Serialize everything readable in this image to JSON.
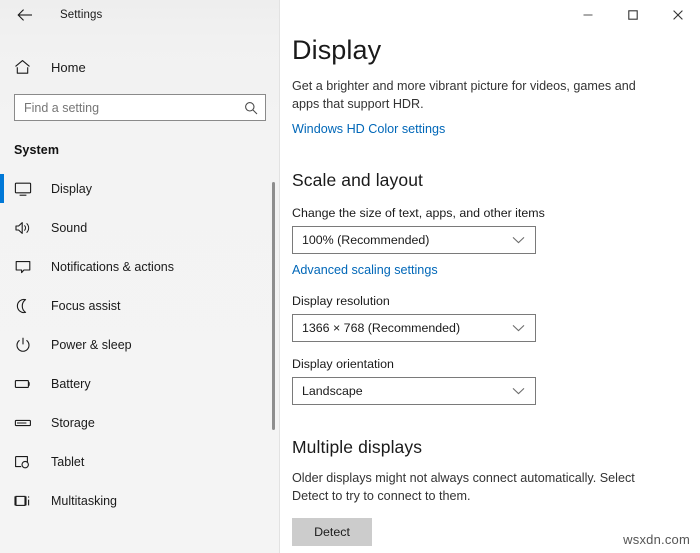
{
  "window": {
    "app_title": "Settings",
    "back_icon": "back-arrow-icon",
    "controls": {
      "minimize_label": "Minimize",
      "maximize_label": "Maximize",
      "close_label": "Close"
    }
  },
  "sidebar": {
    "home_label": "Home",
    "home_icon": "home-icon",
    "search": {
      "placeholder": "Find a setting",
      "value": "",
      "icon": "search-icon"
    },
    "section_label": "System",
    "accent_color": "#0078d7",
    "items": [
      {
        "label": "Display",
        "icon": "monitor-icon",
        "selected": true
      },
      {
        "label": "Sound",
        "icon": "speaker-icon",
        "selected": false
      },
      {
        "label": "Notifications & actions",
        "icon": "notification-icon",
        "selected": false
      },
      {
        "label": "Focus assist",
        "icon": "moon-icon",
        "selected": false
      },
      {
        "label": "Power & sleep",
        "icon": "power-icon",
        "selected": false
      },
      {
        "label": "Battery",
        "icon": "battery-icon",
        "selected": false
      },
      {
        "label": "Storage",
        "icon": "storage-icon",
        "selected": false
      },
      {
        "label": "Tablet",
        "icon": "tablet-icon",
        "selected": false
      },
      {
        "label": "Multitasking",
        "icon": "multitasking-icon",
        "selected": false
      }
    ]
  },
  "main": {
    "page_title": "Display",
    "hdr_description": "Get a brighter and more vibrant picture for videos, games and apps that support HDR.",
    "hd_color_link": "Windows HD Color settings",
    "link_color": "#0067b8",
    "scale_section": {
      "title": "Scale and layout",
      "scale_label": "Change the size of text, apps, and other items",
      "scale_value": "100% (Recommended)",
      "advanced_link": "Advanced scaling settings",
      "resolution_label": "Display resolution",
      "resolution_value": "1366 × 768 (Recommended)",
      "orientation_label": "Display orientation",
      "orientation_value": "Landscape"
    },
    "multiple_displays": {
      "title": "Multiple displays",
      "description": "Older displays might not always connect automatically. Select Detect to try to connect to them.",
      "detect_label": "Detect"
    }
  },
  "watermark": "wsxdn.com"
}
